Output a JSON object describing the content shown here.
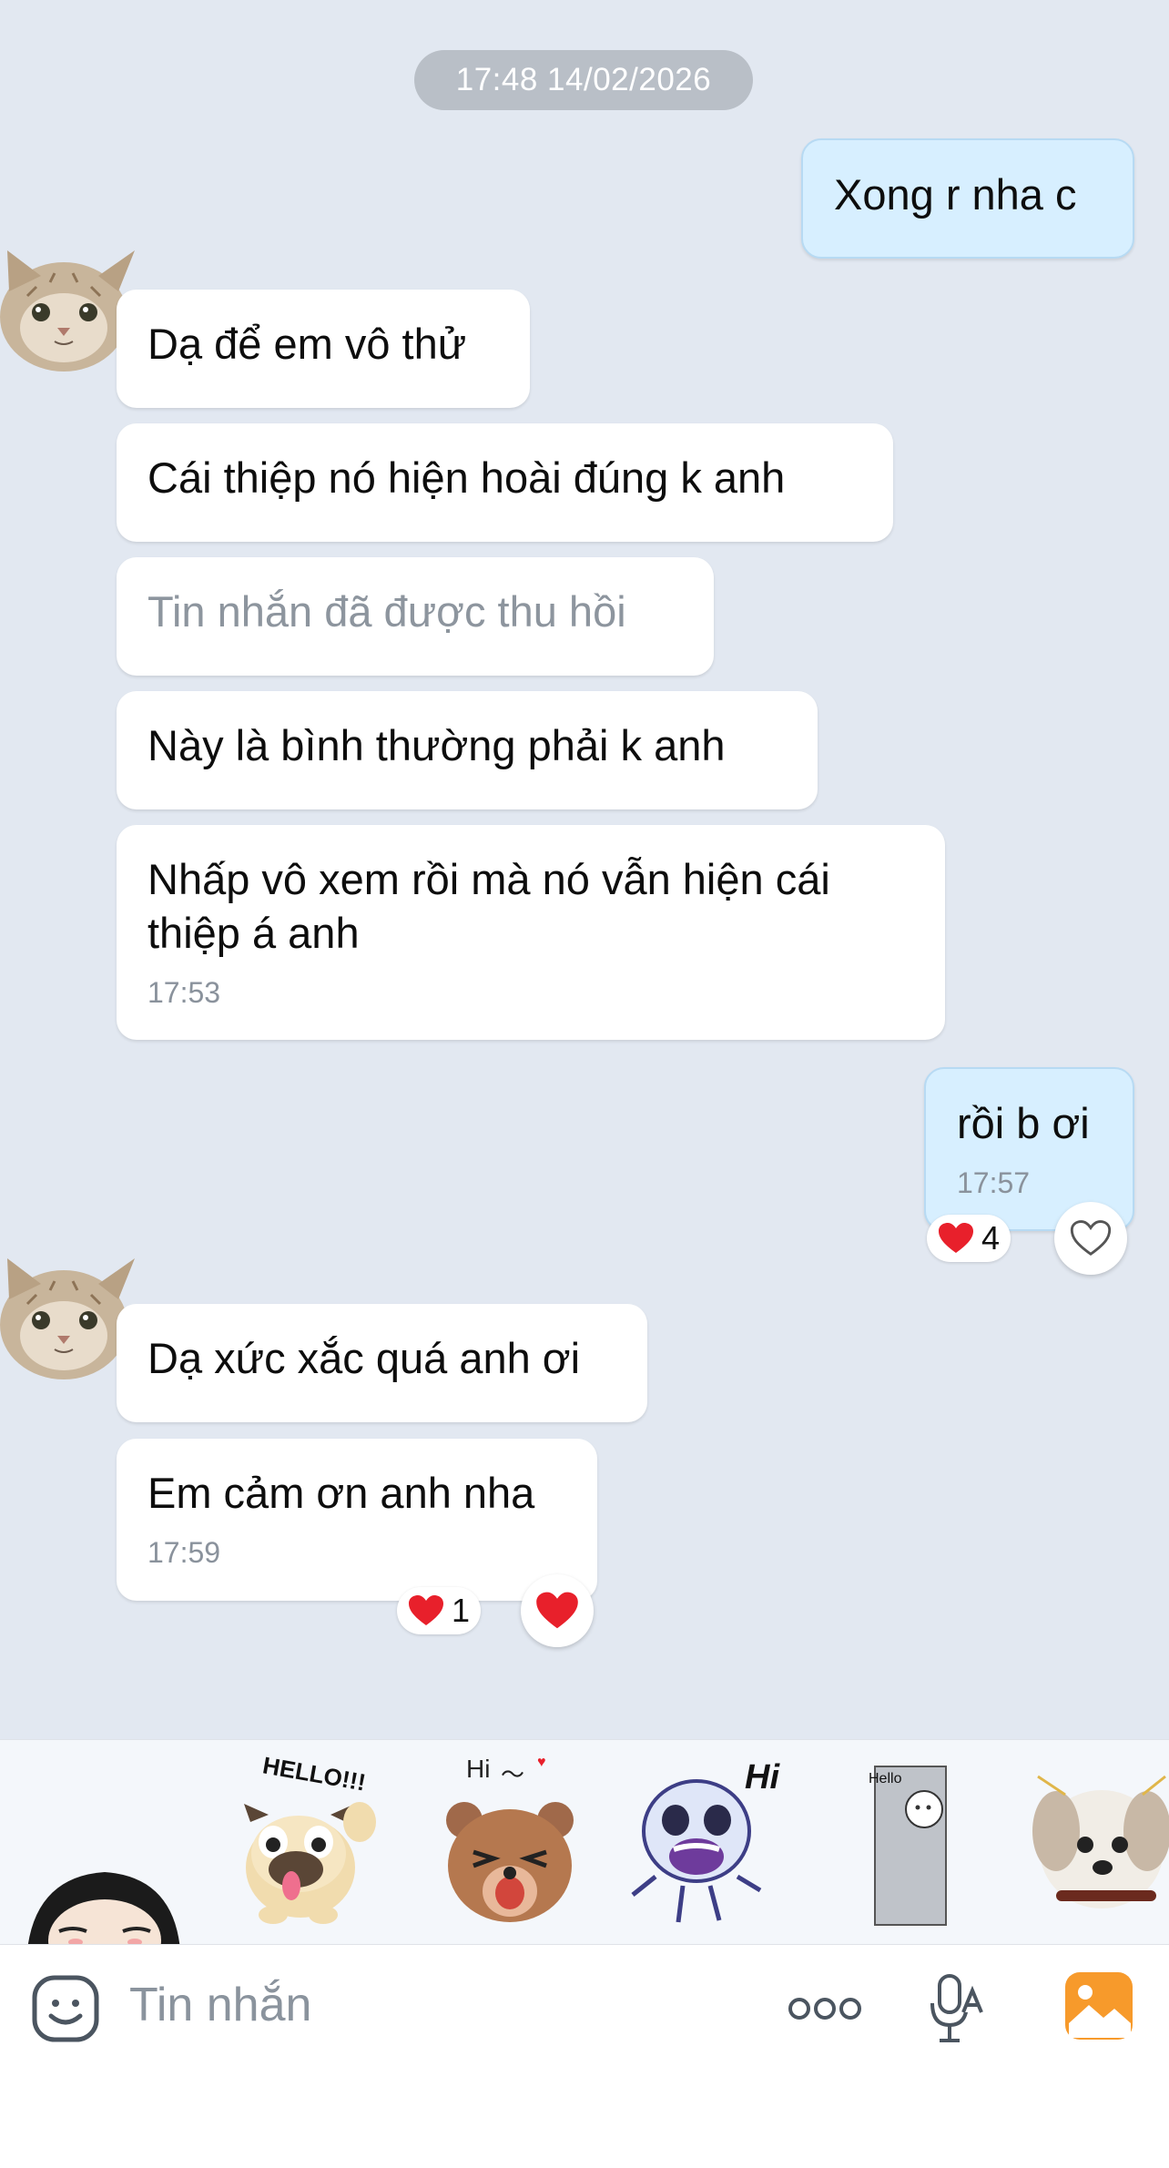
{
  "chat": {
    "date_divider": "17:48 14/02/2026",
    "messages": [
      {
        "text": "Xong r nha c"
      },
      {
        "text": "Dạ để em vô thử"
      },
      {
        "text": "Cái thiệp nó hiện hoài đúng k anh"
      },
      {
        "text": "Tin nhắn đã được thu hồi"
      },
      {
        "text": "Này là bình thường phải k anh"
      },
      {
        "text": "Nhấp vô xem rồi mà nó vẫn hiện cái thiệp á anh",
        "time": "17:53"
      },
      {
        "text": "rồi b ơi",
        "time": "17:57",
        "reaction_count": "4"
      },
      {
        "text": "Dạ xức xắc quá anh ơi"
      },
      {
        "text": "Em cảm ơn anh nha",
        "time": "17:59",
        "reaction_count": "1"
      }
    ]
  },
  "stickers": {
    "items": [
      {
        "name": "girl-sticker",
        "caption": ""
      },
      {
        "name": "pug-hello-sticker",
        "caption": "HELLO!!!"
      },
      {
        "name": "bear-hi-sticker",
        "caption": "Hi"
      },
      {
        "name": "skeleton-hi-sticker",
        "caption": "Hi"
      },
      {
        "name": "bear-door-sticker",
        "caption": "Hello"
      },
      {
        "name": "dog-sticker",
        "caption": ""
      }
    ]
  },
  "composer": {
    "placeholder": "Tin nhắn"
  },
  "colors": {
    "background": "#e2e8f1",
    "outgoing_bubble": "#d7efff",
    "incoming_bubble": "#ffffff",
    "heart": "#e8202b",
    "accent": "#f79a2b"
  }
}
